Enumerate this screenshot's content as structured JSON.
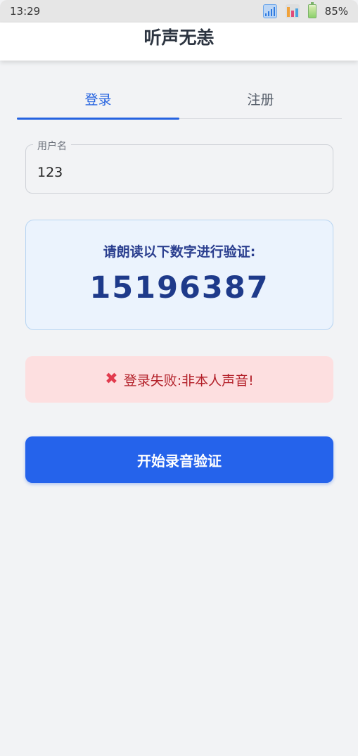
{
  "status_bar": {
    "time": "13:29",
    "battery_percent": "85%",
    "signal_icon": "signal-icon",
    "data_icon": "data-bars-icon",
    "battery_icon": "battery-icon"
  },
  "header": {
    "title": "听声无恙"
  },
  "tabs": [
    {
      "label": "登录",
      "active": true
    },
    {
      "label": "注册",
      "active": false
    }
  ],
  "username_field": {
    "label": "用户名",
    "value": "123"
  },
  "verification": {
    "prompt": "请朗读以下数字进行验证:",
    "code": "15196387"
  },
  "error": {
    "icon": "cross-icon",
    "message": "登录失败:非本人声音!"
  },
  "record_button": {
    "label": "开始录音验证"
  },
  "colors": {
    "accent": "#2563eb",
    "error_bg": "#fddfe0",
    "error_text": "#b32029",
    "card_bg": "#ebf3fd"
  }
}
